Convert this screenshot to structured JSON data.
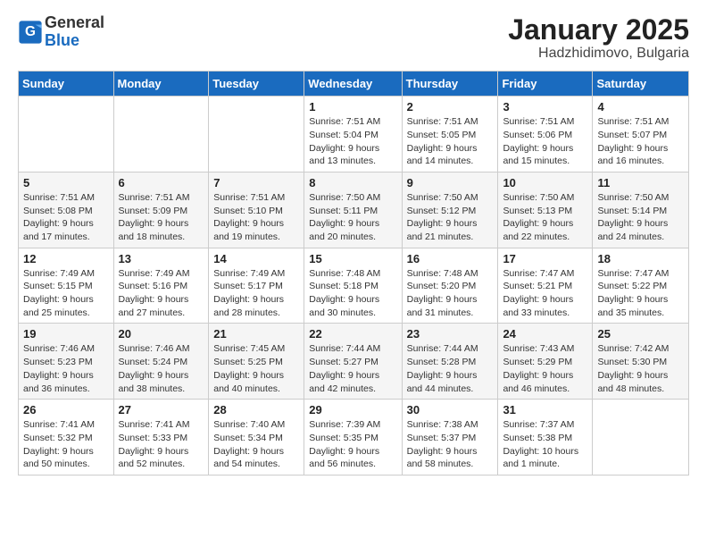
{
  "header": {
    "logo_general": "General",
    "logo_blue": "Blue",
    "title": "January 2025",
    "subtitle": "Hadzhidimovo, Bulgaria"
  },
  "weekdays": [
    "Sunday",
    "Monday",
    "Tuesday",
    "Wednesday",
    "Thursday",
    "Friday",
    "Saturday"
  ],
  "weeks": [
    [
      {
        "day": "",
        "info": ""
      },
      {
        "day": "",
        "info": ""
      },
      {
        "day": "",
        "info": ""
      },
      {
        "day": "1",
        "info": "Sunrise: 7:51 AM\nSunset: 5:04 PM\nDaylight: 9 hours\nand 13 minutes."
      },
      {
        "day": "2",
        "info": "Sunrise: 7:51 AM\nSunset: 5:05 PM\nDaylight: 9 hours\nand 14 minutes."
      },
      {
        "day": "3",
        "info": "Sunrise: 7:51 AM\nSunset: 5:06 PM\nDaylight: 9 hours\nand 15 minutes."
      },
      {
        "day": "4",
        "info": "Sunrise: 7:51 AM\nSunset: 5:07 PM\nDaylight: 9 hours\nand 16 minutes."
      }
    ],
    [
      {
        "day": "5",
        "info": "Sunrise: 7:51 AM\nSunset: 5:08 PM\nDaylight: 9 hours\nand 17 minutes."
      },
      {
        "day": "6",
        "info": "Sunrise: 7:51 AM\nSunset: 5:09 PM\nDaylight: 9 hours\nand 18 minutes."
      },
      {
        "day": "7",
        "info": "Sunrise: 7:51 AM\nSunset: 5:10 PM\nDaylight: 9 hours\nand 19 minutes."
      },
      {
        "day": "8",
        "info": "Sunrise: 7:50 AM\nSunset: 5:11 PM\nDaylight: 9 hours\nand 20 minutes."
      },
      {
        "day": "9",
        "info": "Sunrise: 7:50 AM\nSunset: 5:12 PM\nDaylight: 9 hours\nand 21 minutes."
      },
      {
        "day": "10",
        "info": "Sunrise: 7:50 AM\nSunset: 5:13 PM\nDaylight: 9 hours\nand 22 minutes."
      },
      {
        "day": "11",
        "info": "Sunrise: 7:50 AM\nSunset: 5:14 PM\nDaylight: 9 hours\nand 24 minutes."
      }
    ],
    [
      {
        "day": "12",
        "info": "Sunrise: 7:49 AM\nSunset: 5:15 PM\nDaylight: 9 hours\nand 25 minutes."
      },
      {
        "day": "13",
        "info": "Sunrise: 7:49 AM\nSunset: 5:16 PM\nDaylight: 9 hours\nand 27 minutes."
      },
      {
        "day": "14",
        "info": "Sunrise: 7:49 AM\nSunset: 5:17 PM\nDaylight: 9 hours\nand 28 minutes."
      },
      {
        "day": "15",
        "info": "Sunrise: 7:48 AM\nSunset: 5:18 PM\nDaylight: 9 hours\nand 30 minutes."
      },
      {
        "day": "16",
        "info": "Sunrise: 7:48 AM\nSunset: 5:20 PM\nDaylight: 9 hours\nand 31 minutes."
      },
      {
        "day": "17",
        "info": "Sunrise: 7:47 AM\nSunset: 5:21 PM\nDaylight: 9 hours\nand 33 minutes."
      },
      {
        "day": "18",
        "info": "Sunrise: 7:47 AM\nSunset: 5:22 PM\nDaylight: 9 hours\nand 35 minutes."
      }
    ],
    [
      {
        "day": "19",
        "info": "Sunrise: 7:46 AM\nSunset: 5:23 PM\nDaylight: 9 hours\nand 36 minutes."
      },
      {
        "day": "20",
        "info": "Sunrise: 7:46 AM\nSunset: 5:24 PM\nDaylight: 9 hours\nand 38 minutes."
      },
      {
        "day": "21",
        "info": "Sunrise: 7:45 AM\nSunset: 5:25 PM\nDaylight: 9 hours\nand 40 minutes."
      },
      {
        "day": "22",
        "info": "Sunrise: 7:44 AM\nSunset: 5:27 PM\nDaylight: 9 hours\nand 42 minutes."
      },
      {
        "day": "23",
        "info": "Sunrise: 7:44 AM\nSunset: 5:28 PM\nDaylight: 9 hours\nand 44 minutes."
      },
      {
        "day": "24",
        "info": "Sunrise: 7:43 AM\nSunset: 5:29 PM\nDaylight: 9 hours\nand 46 minutes."
      },
      {
        "day": "25",
        "info": "Sunrise: 7:42 AM\nSunset: 5:30 PM\nDaylight: 9 hours\nand 48 minutes."
      }
    ],
    [
      {
        "day": "26",
        "info": "Sunrise: 7:41 AM\nSunset: 5:32 PM\nDaylight: 9 hours\nand 50 minutes."
      },
      {
        "day": "27",
        "info": "Sunrise: 7:41 AM\nSunset: 5:33 PM\nDaylight: 9 hours\nand 52 minutes."
      },
      {
        "day": "28",
        "info": "Sunrise: 7:40 AM\nSunset: 5:34 PM\nDaylight: 9 hours\nand 54 minutes."
      },
      {
        "day": "29",
        "info": "Sunrise: 7:39 AM\nSunset: 5:35 PM\nDaylight: 9 hours\nand 56 minutes."
      },
      {
        "day": "30",
        "info": "Sunrise: 7:38 AM\nSunset: 5:37 PM\nDaylight: 9 hours\nand 58 minutes."
      },
      {
        "day": "31",
        "info": "Sunrise: 7:37 AM\nSunset: 5:38 PM\nDaylight: 10 hours\nand 1 minute."
      },
      {
        "day": "",
        "info": ""
      }
    ]
  ]
}
